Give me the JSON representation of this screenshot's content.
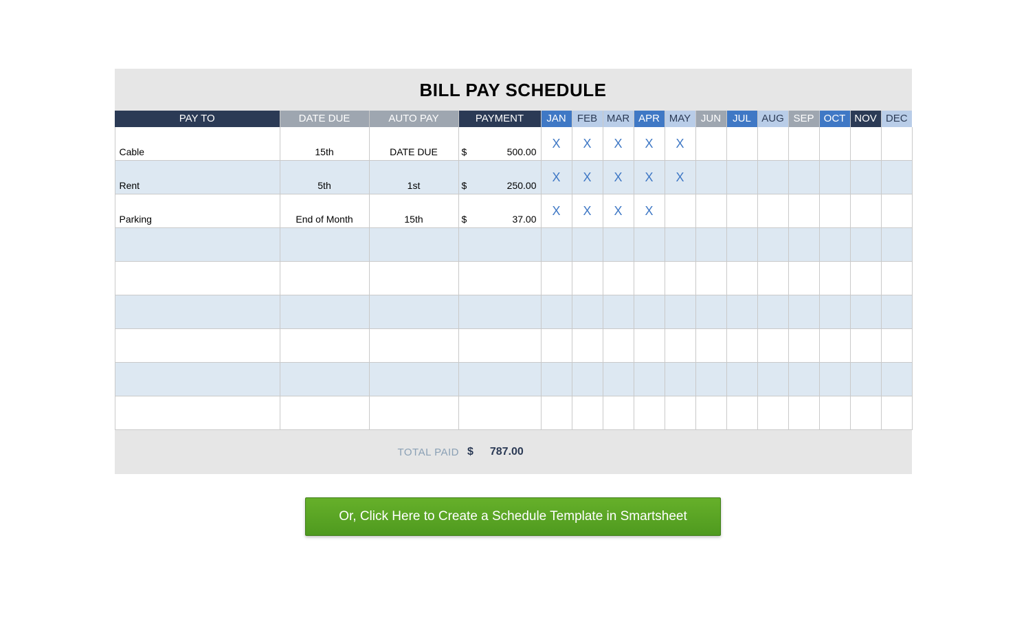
{
  "title": "BILL PAY SCHEDULE",
  "headers": {
    "payto": {
      "label": "PAY TO",
      "style": "hdr-dark"
    },
    "datedue": {
      "label": "DATE DUE",
      "style": "hdr-gray"
    },
    "autopay": {
      "label": "AUTO PAY",
      "style": "hdr-gray"
    },
    "payment": {
      "label": "PAYMENT",
      "style": "hdr-dark"
    }
  },
  "months": [
    {
      "label": "JAN",
      "style": "hdr-blue"
    },
    {
      "label": "FEB",
      "style": "hdr-light"
    },
    {
      "label": "MAR",
      "style": "hdr-light"
    },
    {
      "label": "APR",
      "style": "hdr-blue"
    },
    {
      "label": "MAY",
      "style": "hdr-light"
    },
    {
      "label": "JUN",
      "style": "hdr-gray"
    },
    {
      "label": "JUL",
      "style": "hdr-blue"
    },
    {
      "label": "AUG",
      "style": "hdr-light"
    },
    {
      "label": "SEP",
      "style": "hdr-gray"
    },
    {
      "label": "OCT",
      "style": "hdr-blue"
    },
    {
      "label": "NOV",
      "style": "hdr-dark"
    },
    {
      "label": "DEC",
      "style": "hdr-light"
    }
  ],
  "currency_symbol": "$",
  "rows": [
    {
      "payto": "Cable",
      "datedue": "15th",
      "autopay": "DATE DUE",
      "payment": "500.00",
      "marks": [
        "X",
        "X",
        "X",
        "X",
        "X",
        "",
        "",
        "",
        "",
        "",
        "",
        ""
      ]
    },
    {
      "payto": "Rent",
      "datedue": "5th",
      "autopay": "1st",
      "payment": "250.00",
      "marks": [
        "X",
        "X",
        "X",
        "X",
        "X",
        "",
        "",
        "",
        "",
        "",
        "",
        ""
      ]
    },
    {
      "payto": "Parking",
      "datedue": "End of Month",
      "autopay": "15th",
      "payment": "37.00",
      "marks": [
        "X",
        "X",
        "X",
        "X",
        "",
        "",
        "",
        "",
        "",
        "",
        "",
        ""
      ]
    },
    {
      "payto": "",
      "datedue": "",
      "autopay": "",
      "payment": "",
      "marks": [
        "",
        "",
        "",
        "",
        "",
        "",
        "",
        "",
        "",
        "",
        "",
        ""
      ]
    },
    {
      "payto": "",
      "datedue": "",
      "autopay": "",
      "payment": "",
      "marks": [
        "",
        "",
        "",
        "",
        "",
        "",
        "",
        "",
        "",
        "",
        "",
        ""
      ]
    },
    {
      "payto": "",
      "datedue": "",
      "autopay": "",
      "payment": "",
      "marks": [
        "",
        "",
        "",
        "",
        "",
        "",
        "",
        "",
        "",
        "",
        "",
        ""
      ]
    },
    {
      "payto": "",
      "datedue": "",
      "autopay": "",
      "payment": "",
      "marks": [
        "",
        "",
        "",
        "",
        "",
        "",
        "",
        "",
        "",
        "",
        "",
        ""
      ]
    },
    {
      "payto": "",
      "datedue": "",
      "autopay": "",
      "payment": "",
      "marks": [
        "",
        "",
        "",
        "",
        "",
        "",
        "",
        "",
        "",
        "",
        "",
        ""
      ]
    },
    {
      "payto": "",
      "datedue": "",
      "autopay": "",
      "payment": "",
      "marks": [
        "",
        "",
        "",
        "",
        "",
        "",
        "",
        "",
        "",
        "",
        "",
        ""
      ]
    }
  ],
  "total": {
    "label": "TOTAL PAID",
    "symbol": "$",
    "value": "787.00"
  },
  "cta_label": "Or, Click Here to Create a Schedule Template in Smartsheet"
}
